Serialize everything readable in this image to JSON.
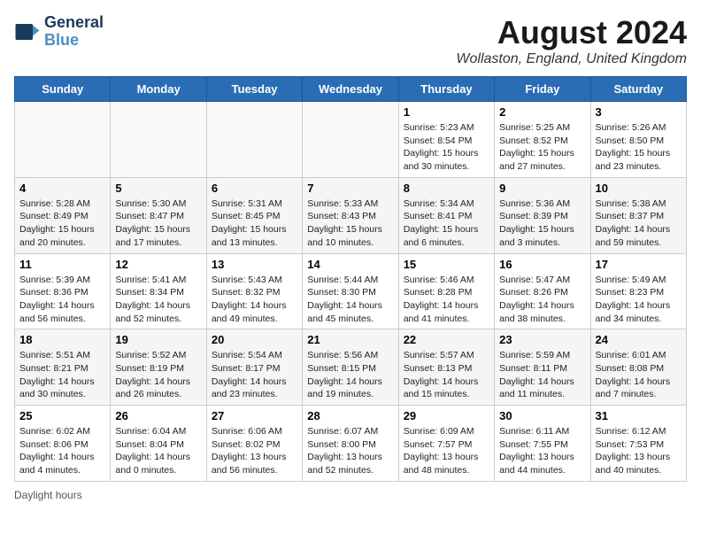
{
  "header": {
    "logo_line1": "General",
    "logo_line2": "Blue",
    "month_year": "August 2024",
    "location": "Wollaston, England, United Kingdom"
  },
  "days_of_week": [
    "Sunday",
    "Monday",
    "Tuesday",
    "Wednesday",
    "Thursday",
    "Friday",
    "Saturday"
  ],
  "weeks": [
    [
      {
        "day": "",
        "sunrise": "",
        "sunset": "",
        "daylight": ""
      },
      {
        "day": "",
        "sunrise": "",
        "sunset": "",
        "daylight": ""
      },
      {
        "day": "",
        "sunrise": "",
        "sunset": "",
        "daylight": ""
      },
      {
        "day": "",
        "sunrise": "",
        "sunset": "",
        "daylight": ""
      },
      {
        "day": "1",
        "sunrise": "5:23 AM",
        "sunset": "8:54 PM",
        "daylight": "15 hours and 30 minutes."
      },
      {
        "day": "2",
        "sunrise": "5:25 AM",
        "sunset": "8:52 PM",
        "daylight": "15 hours and 27 minutes."
      },
      {
        "day": "3",
        "sunrise": "5:26 AM",
        "sunset": "8:50 PM",
        "daylight": "15 hours and 23 minutes."
      }
    ],
    [
      {
        "day": "4",
        "sunrise": "5:28 AM",
        "sunset": "8:49 PM",
        "daylight": "15 hours and 20 minutes."
      },
      {
        "day": "5",
        "sunrise": "5:30 AM",
        "sunset": "8:47 PM",
        "daylight": "15 hours and 17 minutes."
      },
      {
        "day": "6",
        "sunrise": "5:31 AM",
        "sunset": "8:45 PM",
        "daylight": "15 hours and 13 minutes."
      },
      {
        "day": "7",
        "sunrise": "5:33 AM",
        "sunset": "8:43 PM",
        "daylight": "15 hours and 10 minutes."
      },
      {
        "day": "8",
        "sunrise": "5:34 AM",
        "sunset": "8:41 PM",
        "daylight": "15 hours and 6 minutes."
      },
      {
        "day": "9",
        "sunrise": "5:36 AM",
        "sunset": "8:39 PM",
        "daylight": "15 hours and 3 minutes."
      },
      {
        "day": "10",
        "sunrise": "5:38 AM",
        "sunset": "8:37 PM",
        "daylight": "14 hours and 59 minutes."
      }
    ],
    [
      {
        "day": "11",
        "sunrise": "5:39 AM",
        "sunset": "8:36 PM",
        "daylight": "14 hours and 56 minutes."
      },
      {
        "day": "12",
        "sunrise": "5:41 AM",
        "sunset": "8:34 PM",
        "daylight": "14 hours and 52 minutes."
      },
      {
        "day": "13",
        "sunrise": "5:43 AM",
        "sunset": "8:32 PM",
        "daylight": "14 hours and 49 minutes."
      },
      {
        "day": "14",
        "sunrise": "5:44 AM",
        "sunset": "8:30 PM",
        "daylight": "14 hours and 45 minutes."
      },
      {
        "day": "15",
        "sunrise": "5:46 AM",
        "sunset": "8:28 PM",
        "daylight": "14 hours and 41 minutes."
      },
      {
        "day": "16",
        "sunrise": "5:47 AM",
        "sunset": "8:26 PM",
        "daylight": "14 hours and 38 minutes."
      },
      {
        "day": "17",
        "sunrise": "5:49 AM",
        "sunset": "8:23 PM",
        "daylight": "14 hours and 34 minutes."
      }
    ],
    [
      {
        "day": "18",
        "sunrise": "5:51 AM",
        "sunset": "8:21 PM",
        "daylight": "14 hours and 30 minutes."
      },
      {
        "day": "19",
        "sunrise": "5:52 AM",
        "sunset": "8:19 PM",
        "daylight": "14 hours and 26 minutes."
      },
      {
        "day": "20",
        "sunrise": "5:54 AM",
        "sunset": "8:17 PM",
        "daylight": "14 hours and 23 minutes."
      },
      {
        "day": "21",
        "sunrise": "5:56 AM",
        "sunset": "8:15 PM",
        "daylight": "14 hours and 19 minutes."
      },
      {
        "day": "22",
        "sunrise": "5:57 AM",
        "sunset": "8:13 PM",
        "daylight": "14 hours and 15 minutes."
      },
      {
        "day": "23",
        "sunrise": "5:59 AM",
        "sunset": "8:11 PM",
        "daylight": "14 hours and 11 minutes."
      },
      {
        "day": "24",
        "sunrise": "6:01 AM",
        "sunset": "8:08 PM",
        "daylight": "14 hours and 7 minutes."
      }
    ],
    [
      {
        "day": "25",
        "sunrise": "6:02 AM",
        "sunset": "8:06 PM",
        "daylight": "14 hours and 4 minutes."
      },
      {
        "day": "26",
        "sunrise": "6:04 AM",
        "sunset": "8:04 PM",
        "daylight": "14 hours and 0 minutes."
      },
      {
        "day": "27",
        "sunrise": "6:06 AM",
        "sunset": "8:02 PM",
        "daylight": "13 hours and 56 minutes."
      },
      {
        "day": "28",
        "sunrise": "6:07 AM",
        "sunset": "8:00 PM",
        "daylight": "13 hours and 52 minutes."
      },
      {
        "day": "29",
        "sunrise": "6:09 AM",
        "sunset": "7:57 PM",
        "daylight": "13 hours and 48 minutes."
      },
      {
        "day": "30",
        "sunrise": "6:11 AM",
        "sunset": "7:55 PM",
        "daylight": "13 hours and 44 minutes."
      },
      {
        "day": "31",
        "sunrise": "6:12 AM",
        "sunset": "7:53 PM",
        "daylight": "13 hours and 40 minutes."
      }
    ]
  ],
  "footer": {
    "text": "Daylight hours"
  }
}
